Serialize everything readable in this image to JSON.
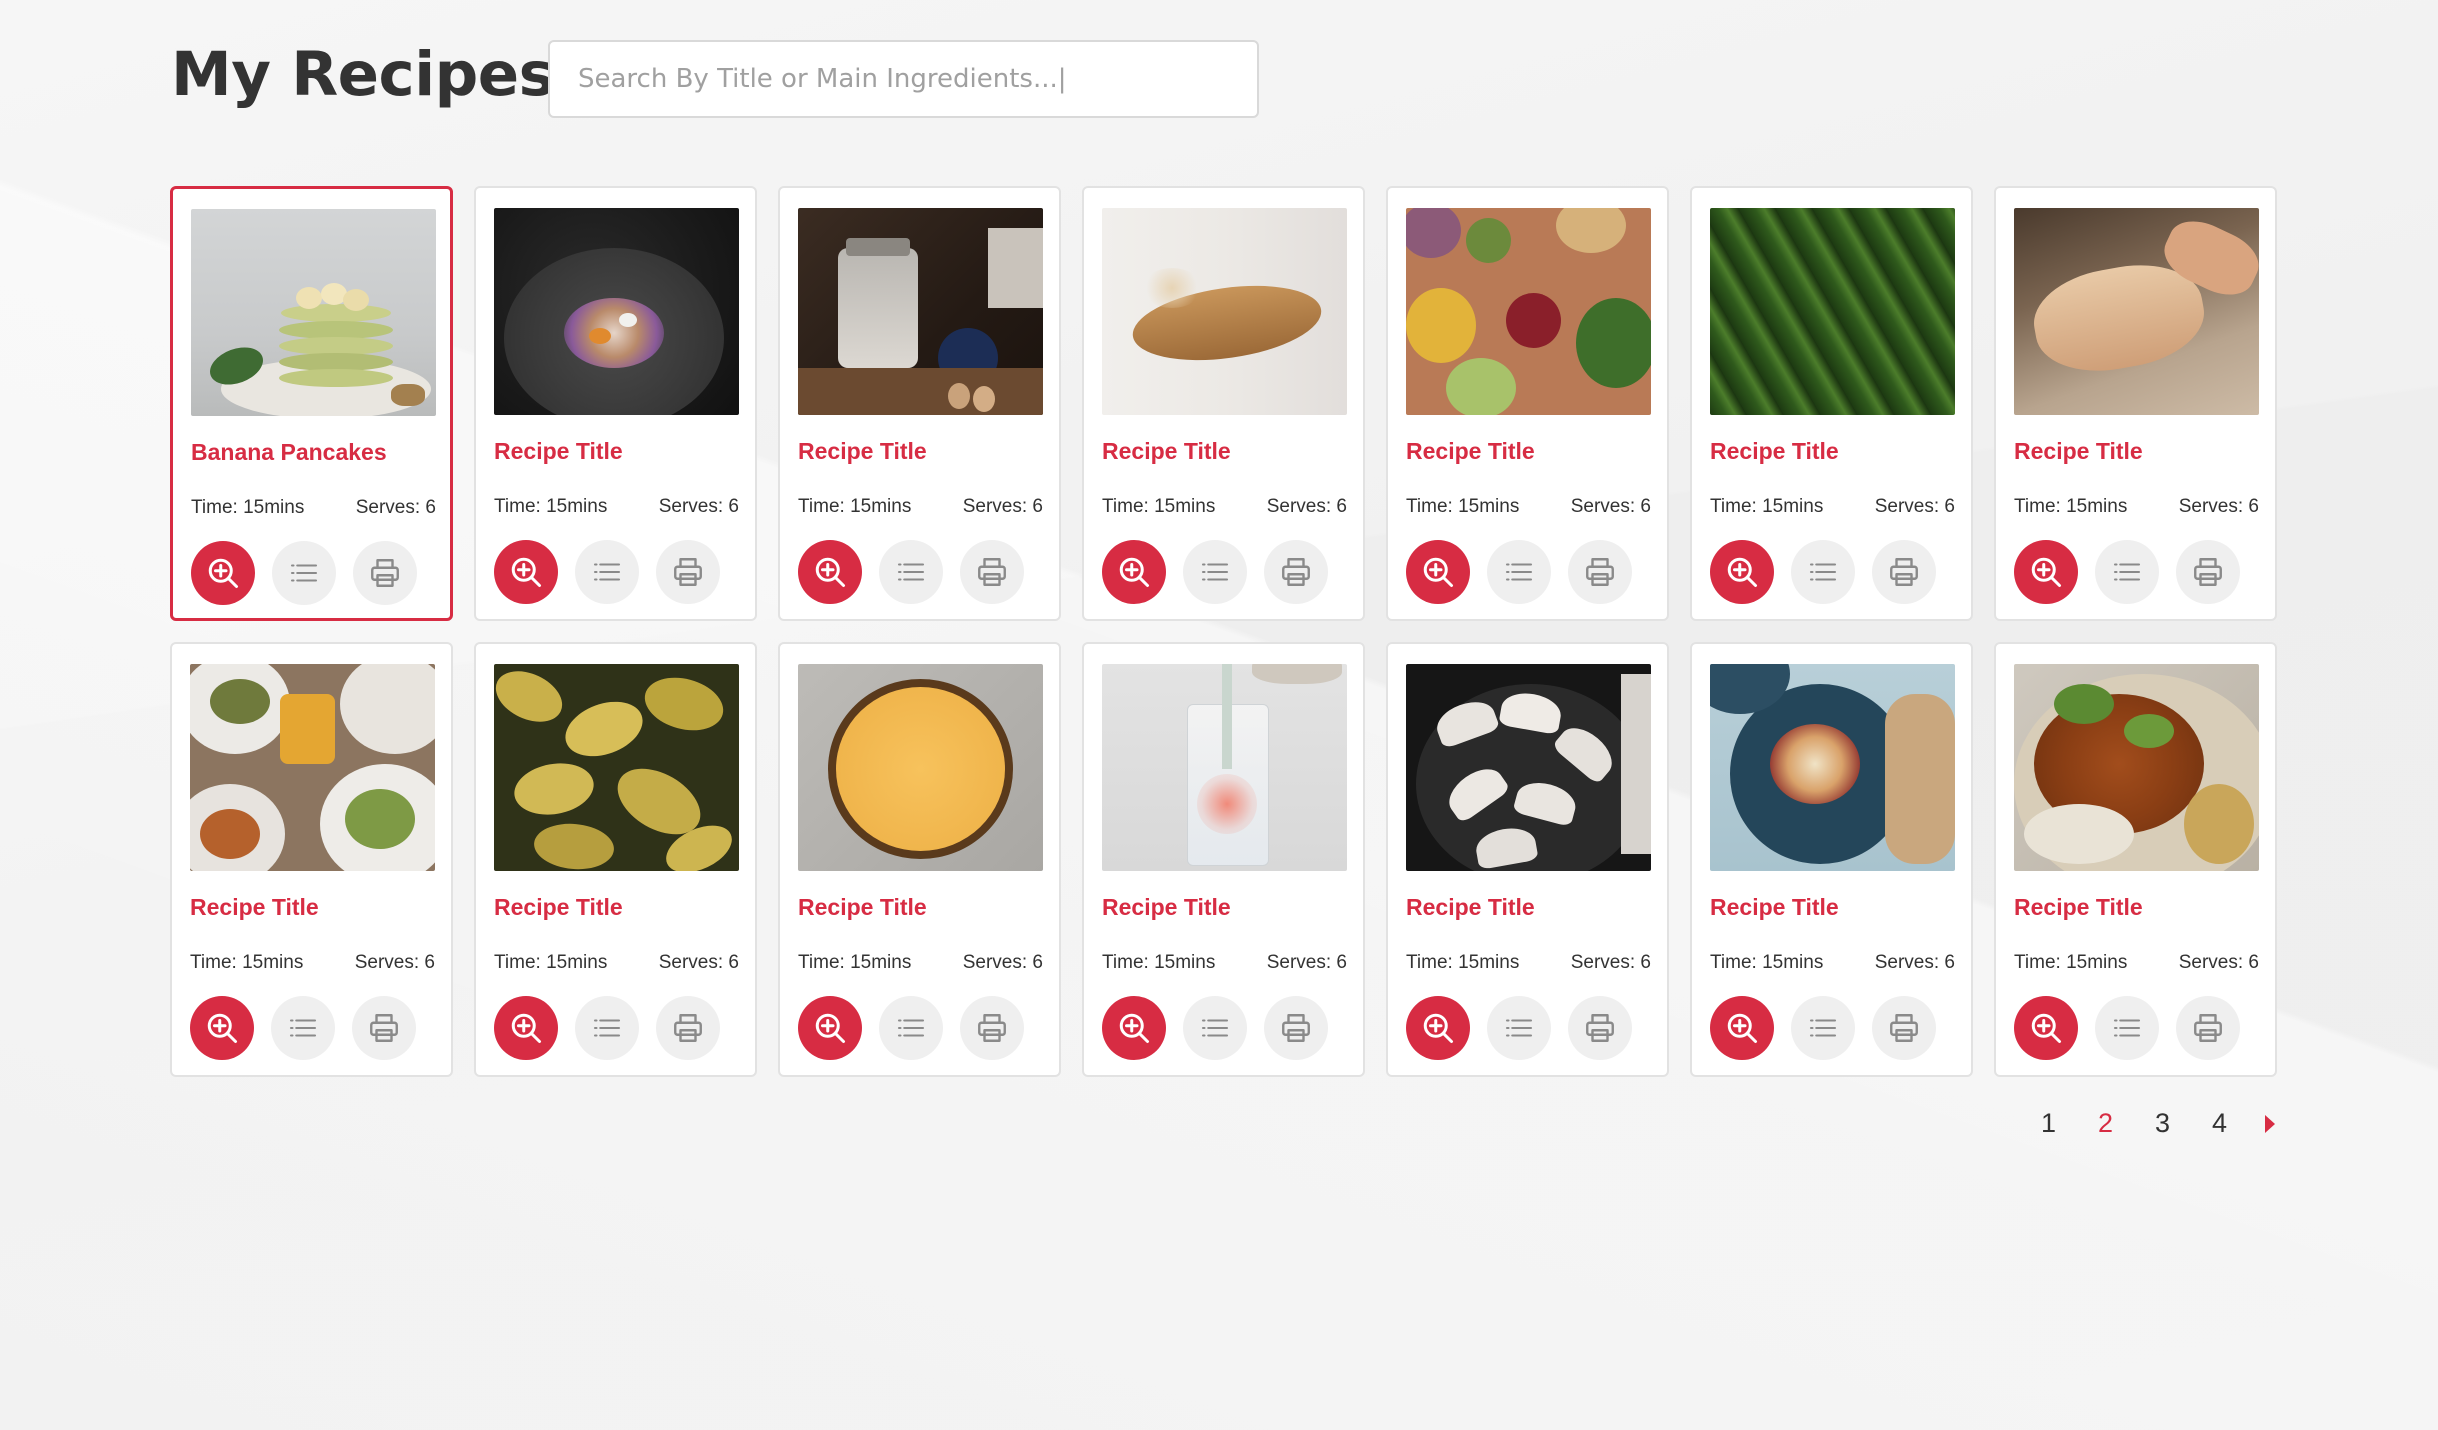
{
  "header": {
    "title": "My Recipes",
    "search_placeholder": "Search By Title or Main Ingredients...|"
  },
  "colors": {
    "accent": "#d72c43",
    "text": "#333333",
    "button_bg": "#efefef",
    "card_border": "#e2e2e2"
  },
  "recipes": [
    {
      "title": "Banana Pancakes",
      "time": "Time: 15mins",
      "serves": "Serves: 6",
      "selected": true
    },
    {
      "title": "Recipe Title",
      "time": "Time: 15mins",
      "serves": "Serves: 6"
    },
    {
      "title": "Recipe Title",
      "time": "Time: 15mins",
      "serves": "Serves: 6"
    },
    {
      "title": "Recipe Title",
      "time": "Time: 15mins",
      "serves": "Serves: 6"
    },
    {
      "title": "Recipe Title",
      "time": "Time: 15mins",
      "serves": "Serves: 6"
    },
    {
      "title": "Recipe Title",
      "time": "Time: 15mins",
      "serves": "Serves: 6"
    },
    {
      "title": "Recipe Title",
      "time": "Time: 15mins",
      "serves": "Serves: 6"
    },
    {
      "title": "Recipe Title",
      "time": "Time: 15mins",
      "serves": "Serves: 6"
    },
    {
      "title": "Recipe Title",
      "time": "Time: 15mins",
      "serves": "Serves: 6"
    },
    {
      "title": "Recipe Title",
      "time": "Time: 15mins",
      "serves": "Serves: 6"
    },
    {
      "title": "Recipe Title",
      "time": "Time: 15mins",
      "serves": "Serves: 6"
    },
    {
      "title": "Recipe Title",
      "time": "Time: 15mins",
      "serves": "Serves: 6"
    },
    {
      "title": "Recipe Title",
      "time": "Time: 15mins",
      "serves": "Serves: 6"
    },
    {
      "title": "Recipe Title",
      "time": "Time: 15mins",
      "serves": "Serves: 6"
    }
  ],
  "card_actions": {
    "view_icon": "zoom-in-icon",
    "ingredients_icon": "list-icon",
    "print_icon": "printer-icon"
  },
  "pagination": {
    "pages": [
      "1",
      "2",
      "3",
      "4"
    ],
    "current": "2",
    "next_icon": "caret-right-icon"
  }
}
